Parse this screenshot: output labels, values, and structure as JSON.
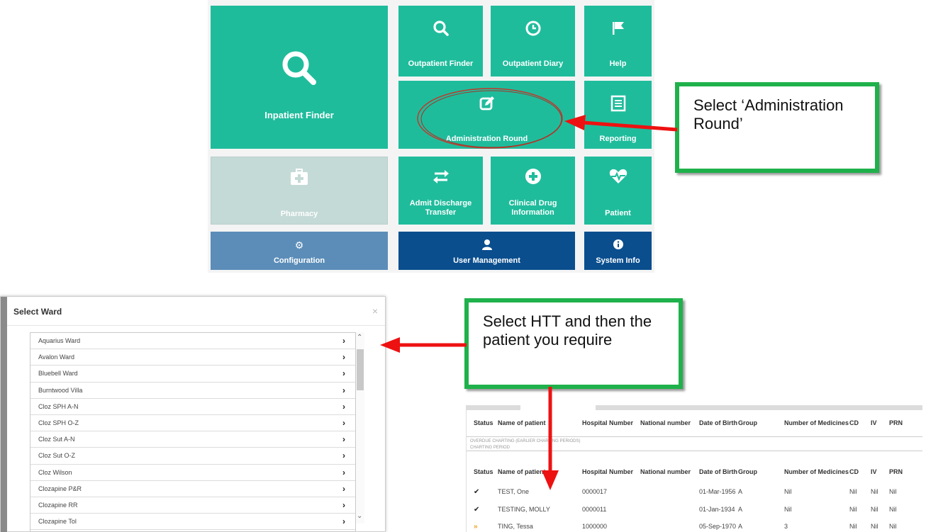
{
  "dashboard": {
    "tiles": {
      "inpatient_finder": "Inpatient Finder",
      "outpatient_finder": "Outpatient Finder",
      "outpatient_diary": "Outpatient Diary",
      "help": "Help",
      "administration_round": "Administration Round",
      "reporting": "Reporting",
      "pharmacy": "Pharmacy",
      "admit_discharge_transfer": "Admit Discharge Transfer",
      "clinical_drug_information": "Clinical Drug Information",
      "patient": "Patient",
      "configuration": "Configuration",
      "user_management": "User Management",
      "system_info": "System Info"
    },
    "colors": {
      "teal": "#1fbc9c",
      "grey": "#c4dad6",
      "steel": "#5b8db8",
      "navy": "#0a4e8e"
    }
  },
  "callouts": {
    "admin_round": "Select ‘Administration Round’",
    "htt": "Select HTT and then the patient you require"
  },
  "select_ward": {
    "title": "Select Ward",
    "close": "×",
    "wards": [
      "Aquarius Ward",
      "Avalon Ward",
      "Bluebell Ward",
      "Burntwood Villa",
      "Cloz SPH A-N",
      "Cloz SPH O-Z",
      "Cloz Sut A-N",
      "Cloz Sut O-Z",
      "Cloz Wilson",
      "Clozapine P&R",
      "Clozapine RR",
      "Clozapine Tol"
    ]
  },
  "patient_table": {
    "headers": {
      "status": "Status",
      "name": "Name of patient",
      "hospital_number": "Hospital Number",
      "national_number": "National number",
      "dob": "Date of Birth",
      "group": "Group",
      "medicines": "Number of Medicines",
      "cd": "CD",
      "iv": "IV",
      "prn": "PRN"
    },
    "overdue_label": "OVERDUE CHARTING (EARLIER CHARTING PERIODS)",
    "period_label": "CHARTING PERIOD",
    "rows": [
      {
        "status": "✔",
        "name": "TEST, One",
        "hospital_number": "0000017",
        "dob": "01-Mar-1956",
        "group": "A",
        "medicines": "Nil",
        "cd": "Nil",
        "iv": "Nil",
        "prn": "Nil"
      },
      {
        "status": "✔",
        "name": "TESTING, MOLLY",
        "hospital_number": "0000011",
        "dob": "01-Jan-1934",
        "group": "A",
        "medicines": "Nil",
        "cd": "Nil",
        "iv": "Nil",
        "prn": "Nil"
      },
      {
        "status": "»",
        "name": "TING, Tessa",
        "hospital_number": "1000000",
        "dob": "05-Sep-1970",
        "group": "A",
        "medicines": "3",
        "cd": "Nil",
        "iv": "Nil",
        "prn": "Nil"
      }
    ]
  }
}
